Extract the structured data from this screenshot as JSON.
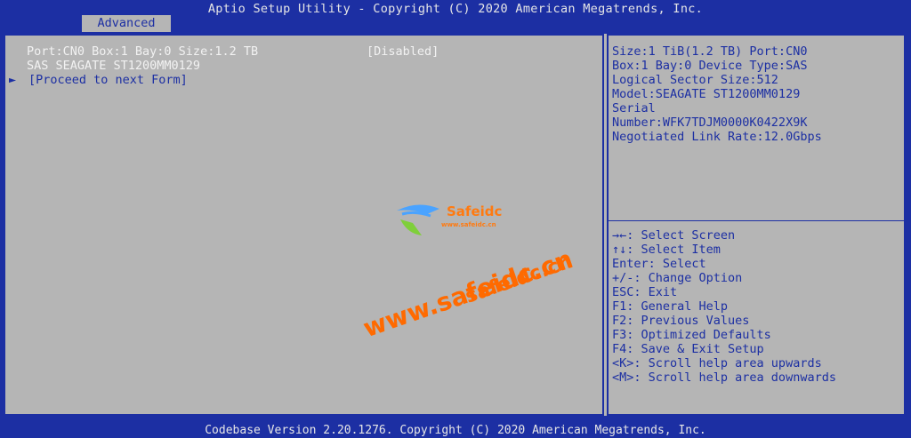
{
  "title": "Aptio Setup Utility - Copyright (C) 2020 American Megatrends, Inc.",
  "tabs": [
    {
      "label": "Advanced"
    }
  ],
  "left": {
    "drive_label": "Port:CN0 Box:1 Bay:0 Size:1.2 TB",
    "drive_value": "[Disabled]",
    "drive_model": "SAS SEAGATE ST1200MM0129",
    "proceed_label": "[Proceed to next Form]",
    "arrow": "►"
  },
  "info": [
    "Size:1 TiB(1.2 TB) Port:CN0",
    "Box:1 Bay:0 Device Type:SAS",
    "Logical Sector Size:512",
    "Model:SEAGATE ST1200MM0129",
    "Serial",
    "Number:WFK7TDJM0000K0422X9K",
    "Negotiated Link Rate:12.0Gbps"
  ],
  "help": [
    "→←: Select Screen",
    "↑↓: Select Item",
    "Enter: Select",
    "+/-: Change Option",
    "ESC: Exit",
    "F1: General Help",
    "F2: Previous Values",
    "F3: Optimized Defaults",
    "F4: Save & Exit Setup",
    "<K>: Scroll help area upwards",
    "<M>: Scroll help area downwards"
  ],
  "footer": "Codebase Version 2.20.1276. Copyright (C) 2020 American Megatrends, Inc.",
  "watermark": {
    "brand": "Safeidc",
    "small_url": "www.safeidc.cn",
    "url1": "safeidc.cn",
    "url2": "www.safeidc.cn"
  },
  "colors": {
    "bios_blue": "#1c2fa3",
    "panel_gray": "#b5b5b5",
    "text_white": "#f2f2f2",
    "watermark_orange": "#ff6a00"
  }
}
